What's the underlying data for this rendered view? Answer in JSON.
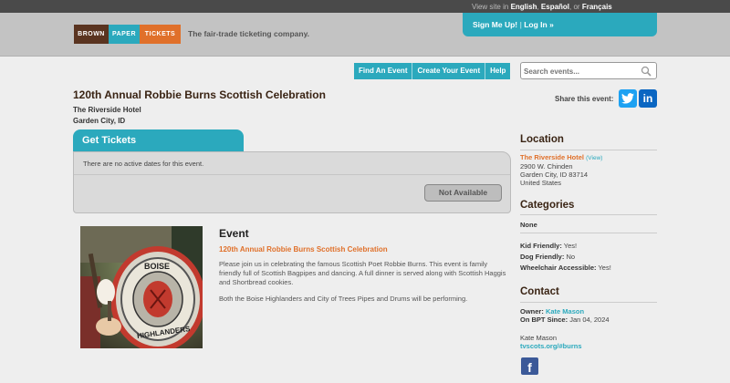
{
  "header": {
    "lang_prefix": "View site in",
    "lang_en": "English",
    "lang_es": "Español",
    "lang_or": "or",
    "lang_fr": "Français",
    "logo": [
      "BROWN",
      "PAPER",
      "TICKETS"
    ],
    "tagline": "The fair-trade ticketing company.",
    "signup": "Sign Me Up!",
    "login": "Log In",
    "login_arrow": "»"
  },
  "nav": {
    "find": "Find An Event",
    "create": "Create Your Event",
    "help": "Help"
  },
  "search": {
    "placeholder": "Search events..."
  },
  "event": {
    "title": "120th Annual Robbie Burns Scottish Celebration",
    "venue": "The Riverside Hotel",
    "city": "Garden City, ID",
    "share_label": "Share this event:"
  },
  "tickets": {
    "tab": "Get Tickets",
    "message": "There are no active dates for this event.",
    "button": "Not Available"
  },
  "event_section": {
    "heading": "Event",
    "subtitle": "120th Annual Robbie Burns Scottish Celebration",
    "para1": "Please join us in celebrating the famous Scottish Poet Robbie Burns. This event is family friendly full of Scottish Bagpipes and dancing.  A full dinner is served along with Scottish Haggis and Shortbread cookies.",
    "para2": "Both the Boise Highlanders and City of Trees Pipes and Drums will be performing.",
    "photo_text_1": "BOISE",
    "photo_text_2": "HIGHLANDERS"
  },
  "location": {
    "heading": "Location",
    "venue": "The Riverside Hotel",
    "view": "(View)",
    "address1": "2900 W. Chinden",
    "address2": "Garden City, ID 83714",
    "country": "United States"
  },
  "categories": {
    "heading": "Categories",
    "value": "None",
    "kid_label": "Kid Friendly:",
    "kid_value": "Yes!",
    "dog_label": "Dog Friendly:",
    "dog_value": "No",
    "wheel_label": "Wheelchair Accessible:",
    "wheel_value": "Yes!"
  },
  "contact": {
    "heading": "Contact",
    "owner_label": "Owner:",
    "owner_value": "Kate Mason",
    "since_label": "On BPT Since:",
    "since_value": "Jan 04, 2024",
    "name": "Kate Mason",
    "link": "tvscots.org/#burns"
  },
  "colors": {
    "teal": "#2ba9bd",
    "orange": "#e0702a",
    "brown": "#5a3420"
  }
}
